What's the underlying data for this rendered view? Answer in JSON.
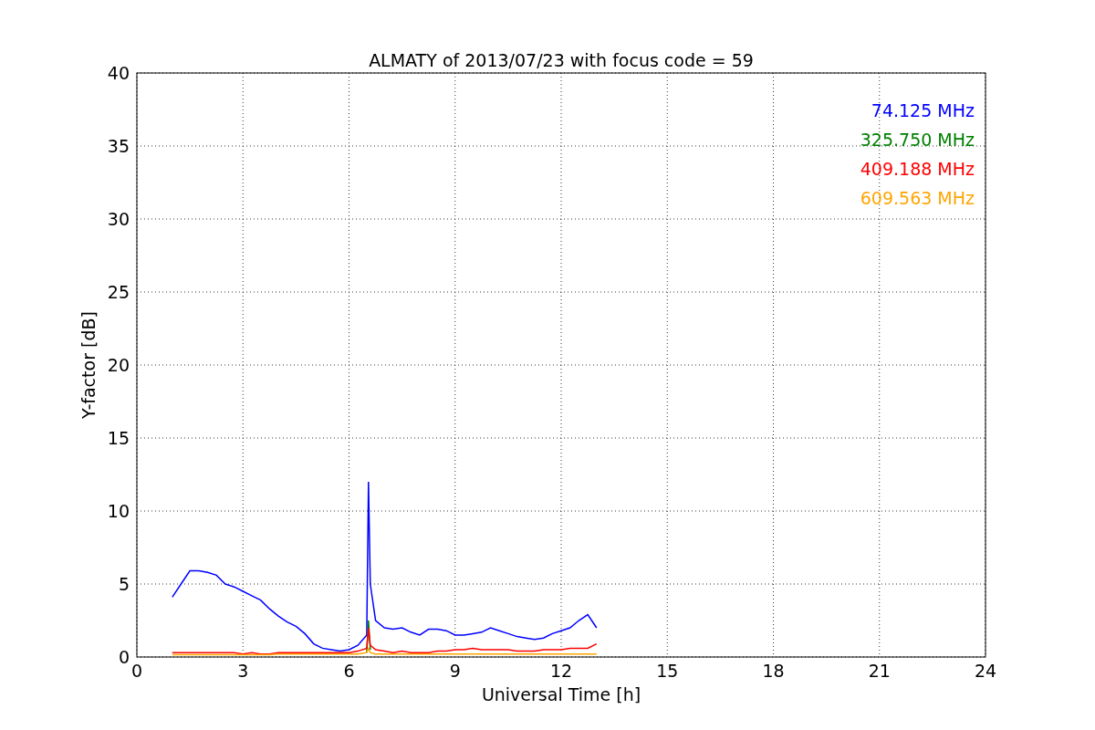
{
  "chart_data": {
    "type": "line",
    "title": "ALMATY of 2013/07/23 with focus code = 59",
    "xlabel": "Universal Time [h]",
    "ylabel": "Y-factor [dB]",
    "x": [
      1,
      1.25,
      1.5,
      1.75,
      2,
      2.25,
      2.5,
      2.75,
      3,
      3.25,
      3.5,
      3.75,
      4,
      4.25,
      4.5,
      4.75,
      5,
      5.25,
      5.5,
      5.75,
      6,
      6.25,
      6.5,
      6.55,
      6.6,
      6.75,
      7,
      7.25,
      7.5,
      7.75,
      8,
      8.25,
      8.5,
      8.75,
      9,
      9.25,
      9.5,
      9.75,
      10,
      10.25,
      10.5,
      10.75,
      11,
      11.25,
      11.5,
      11.75,
      12,
      12.25,
      12.5,
      12.75,
      13
    ],
    "series": [
      {
        "name": "74.125 MHz",
        "color": "#0000ff",
        "values": [
          4.1,
          5.0,
          5.9,
          5.9,
          5.8,
          5.6,
          5.0,
          4.8,
          4.5,
          4.2,
          3.9,
          3.3,
          2.8,
          2.4,
          2.1,
          1.6,
          0.9,
          0.6,
          0.5,
          0.4,
          0.5,
          0.8,
          1.5,
          12.0,
          5.0,
          2.5,
          2.0,
          1.9,
          2.0,
          1.7,
          1.5,
          1.9,
          1.9,
          1.8,
          1.5,
          1.5,
          1.6,
          1.7,
          2.0,
          1.8,
          1.6,
          1.4,
          1.3,
          1.2,
          1.3,
          1.6,
          1.8,
          2.0,
          2.5,
          2.9,
          2.0
        ]
      },
      {
        "name": "325.750 MHz",
        "color": "#008000",
        "values": [
          null,
          null,
          null,
          null,
          null,
          null,
          null,
          null,
          null,
          null,
          null,
          null,
          null,
          null,
          null,
          null,
          null,
          null,
          null,
          null,
          null,
          null,
          0.3,
          2.5,
          0.5,
          null,
          null,
          null,
          null,
          null,
          null,
          null,
          null,
          null,
          null,
          null,
          null,
          null,
          null,
          null,
          null,
          null,
          null,
          null,
          null,
          null,
          null,
          null,
          null,
          null,
          null
        ]
      },
      {
        "name": "409.188 MHz",
        "color": "#ff0000",
        "values": [
          0.3,
          0.3,
          0.3,
          0.3,
          0.3,
          0.3,
          0.3,
          0.3,
          0.2,
          0.3,
          0.2,
          0.2,
          0.3,
          0.3,
          0.3,
          0.3,
          0.3,
          0.3,
          0.3,
          0.3,
          0.3,
          0.4,
          0.6,
          2.0,
          0.8,
          0.5,
          0.4,
          0.3,
          0.4,
          0.3,
          0.3,
          0.3,
          0.4,
          0.4,
          0.5,
          0.5,
          0.6,
          0.5,
          0.5,
          0.5,
          0.5,
          0.4,
          0.4,
          0.4,
          0.5,
          0.5,
          0.5,
          0.6,
          0.6,
          0.6,
          0.9
        ]
      },
      {
        "name": "609.563 MHz",
        "color": "#ffa500",
        "values": [
          0.15,
          0.15,
          0.15,
          0.15,
          0.15,
          0.15,
          0.15,
          0.15,
          0.15,
          0.15,
          0.15,
          0.15,
          0.2,
          0.2,
          0.2,
          0.2,
          0.2,
          0.2,
          0.2,
          0.2,
          0.2,
          0.2,
          0.3,
          0.6,
          0.3,
          0.2,
          0.2,
          0.2,
          0.2,
          0.2,
          0.2,
          0.2,
          0.2,
          0.2,
          0.2,
          0.2,
          0.2,
          0.2,
          0.2,
          0.2,
          0.2,
          0.2,
          0.2,
          0.2,
          0.2,
          0.2,
          0.2,
          0.2,
          0.2,
          0.2,
          0.2
        ]
      }
    ],
    "grid": true,
    "xlim": [
      0,
      24
    ],
    "ylim": [
      0,
      40
    ],
    "xticks": [
      0,
      3,
      6,
      9,
      12,
      15,
      18,
      21,
      24
    ],
    "yticks": [
      0,
      5,
      10,
      15,
      20,
      25,
      30,
      35,
      40
    ]
  }
}
